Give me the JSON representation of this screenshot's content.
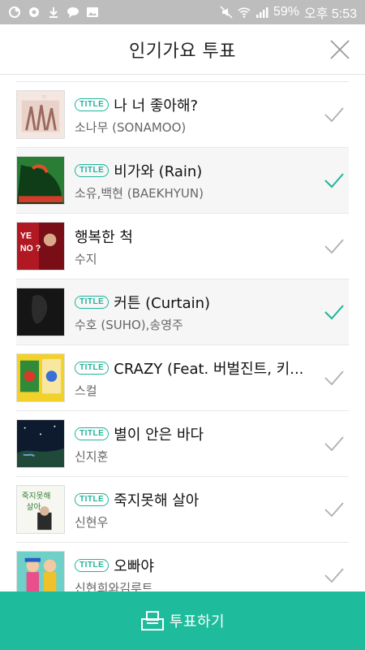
{
  "status_bar": {
    "battery": "59%",
    "time": "오후 5:53",
    "icons": [
      "notification-icon",
      "download-icon",
      "chat-icon",
      "image-icon",
      "mute-icon",
      "wifi-icon",
      "signal-icon"
    ]
  },
  "header": {
    "title": "인기가요 투표",
    "close_icon": "close-icon"
  },
  "badge_label": "TITLE",
  "accent_color": "#1fb59a",
  "songs": [
    {
      "badge": "TITLE",
      "title": "나 너 좋아해?",
      "artist": "소나무 (SONAMOO)",
      "selected": false
    },
    {
      "badge": "TITLE",
      "title": "비가와 (Rain)",
      "artist": "소유,백현 (BAEKHYUN)",
      "selected": true
    },
    {
      "badge": "",
      "title": "행복한 척",
      "artist": "수지",
      "selected": false
    },
    {
      "badge": "TITLE",
      "title": "커튼 (Curtain)",
      "artist": "수호 (SUHO),송영주",
      "selected": true
    },
    {
      "badge": "TITLE",
      "title": "CRAZY (Feat. 버벌진트, 키...",
      "artist": "스컬",
      "selected": false
    },
    {
      "badge": "TITLE",
      "title": "별이 안은 바다",
      "artist": "신지훈",
      "selected": false
    },
    {
      "badge": "TITLE",
      "title": "죽지못해 살아",
      "artist": "신현우",
      "selected": false
    },
    {
      "badge": "TITLE",
      "title": "오빠야",
      "artist": "신현희와김루트",
      "selected": false
    }
  ],
  "vote_button": {
    "label": "투표하기",
    "icon": "ballot-box-icon"
  }
}
